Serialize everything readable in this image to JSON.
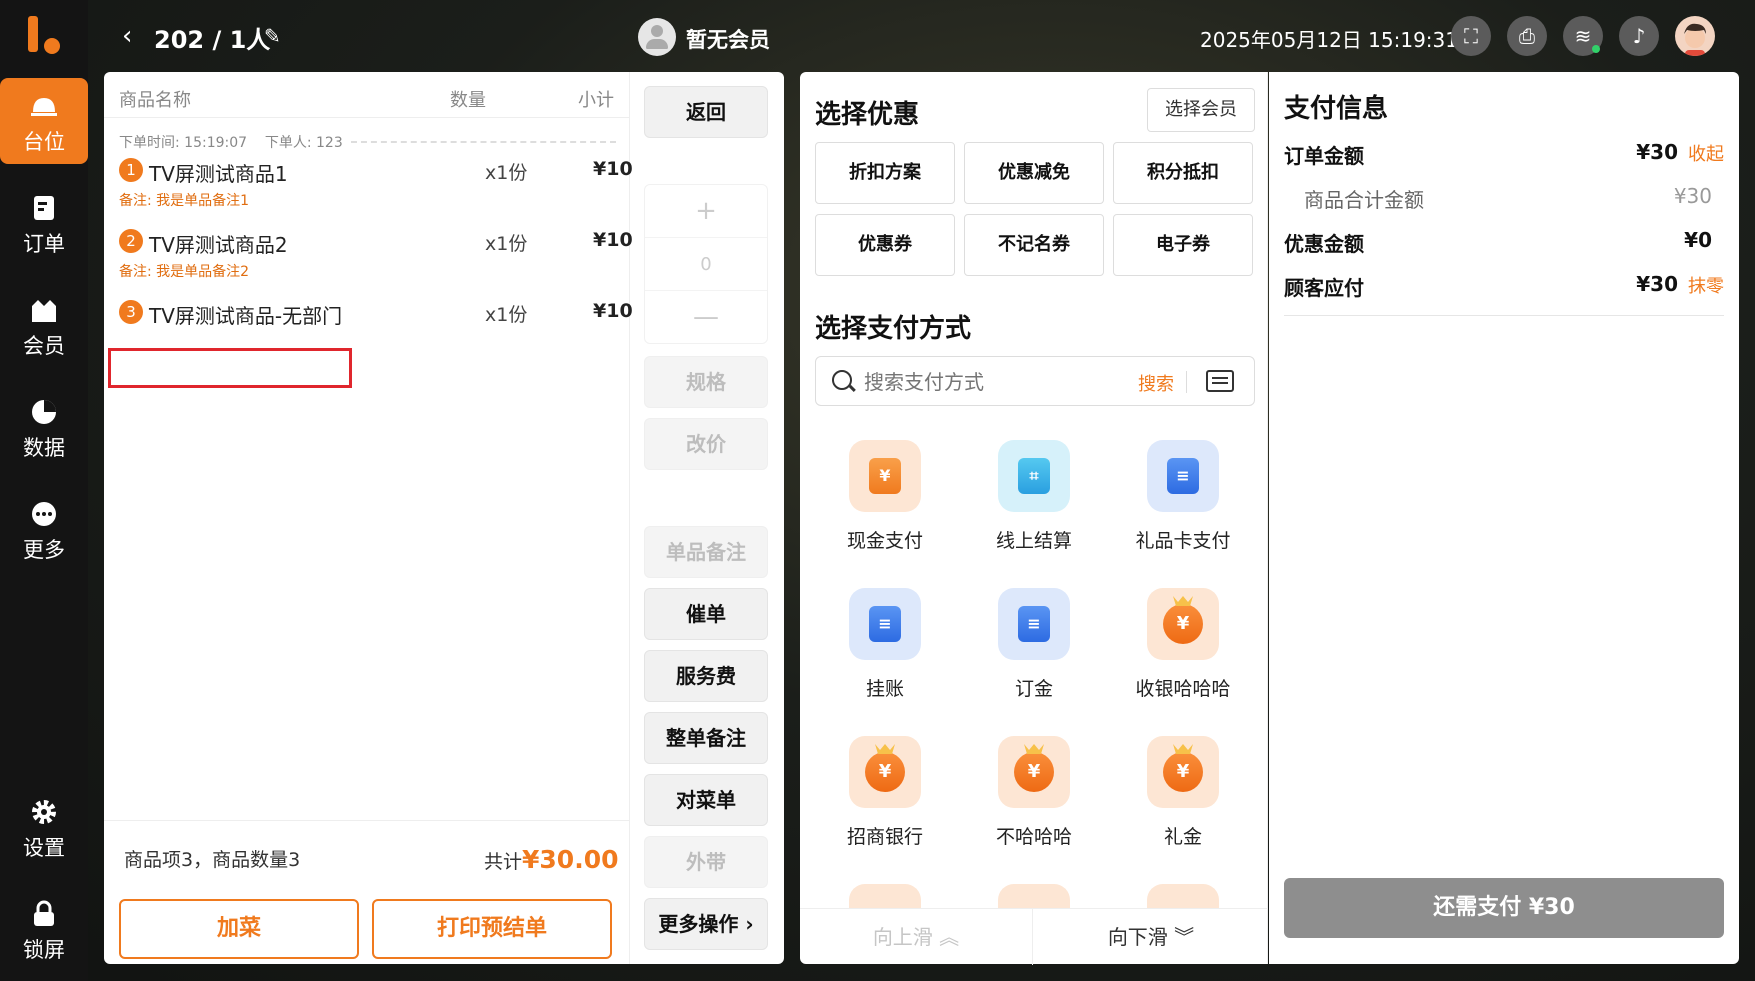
{
  "sidebar": {
    "items": [
      {
        "label": "台位",
        "icon": "table-icon",
        "active": true
      },
      {
        "label": "订单",
        "icon": "order-icon"
      },
      {
        "label": "会员",
        "icon": "member-icon"
      },
      {
        "label": "数据",
        "icon": "chart-icon"
      },
      {
        "label": "更多",
        "icon": "more-icon"
      },
      {
        "label": "设置",
        "icon": "gear-icon"
      },
      {
        "label": "锁屏",
        "icon": "lock-icon"
      }
    ]
  },
  "topbar": {
    "table_title": "202 / 1人",
    "member_status": "暂无会员",
    "datetime": "2025年05月12日 15:19:31"
  },
  "order": {
    "headers": {
      "name": "商品名称",
      "qty": "数量",
      "subtotal": "小计"
    },
    "meta": "下单时间: 15:19:07    下单人: 123",
    "items": [
      {
        "index": "1",
        "name": "TV屏测试商品1",
        "qty": "x1份",
        "price": "¥10",
        "note": "备注: 我是单品备注1"
      },
      {
        "index": "2",
        "name": "TV屏测试商品2",
        "qty": "x1份",
        "price": "¥10",
        "note": "备注: 我是单品备注2"
      },
      {
        "index": "3",
        "name": "TV屏测试商品-无部门",
        "qty": "x1份",
        "price": "¥10",
        "note": ""
      }
    ],
    "summary_count": "商品项3，商品数量3",
    "total_label": "共计",
    "total_value": "¥30.00",
    "add_dish": "加菜",
    "print_pre": "打印预结单"
  },
  "actions": {
    "back": "返回",
    "stepper_plus": "+",
    "stepper_value": "0",
    "stepper_minus": "—",
    "spec": "规格",
    "reprice": "改价",
    "item_note": "单品备注",
    "rush": "催单",
    "service_fee": "服务费",
    "order_note": "整单备注",
    "check_dish": "对菜单",
    "takeout": "外带",
    "more_ops": "更多操作"
  },
  "discount": {
    "title": "选择优惠",
    "select_member": "选择会员",
    "options": [
      "折扣方案",
      "优惠减免",
      "积分抵扣",
      "优惠券",
      "不记名券",
      "电子券"
    ]
  },
  "payment": {
    "title": "选择支付方式",
    "search_placeholder": "搜索支付方式",
    "search_button": "搜索",
    "methods": [
      {
        "label": "现金支付",
        "icon": "cash-icon",
        "glyph": "¥"
      },
      {
        "label": "线上结算",
        "icon": "online-scan-icon",
        "glyph": "⌗"
      },
      {
        "label": "礼品卡支付",
        "icon": "gift-card-icon",
        "glyph": "≡"
      },
      {
        "label": "挂账",
        "icon": "credit-icon",
        "glyph": "≡"
      },
      {
        "label": "订金",
        "icon": "deposit-icon",
        "glyph": "≡"
      },
      {
        "label": "收银哈哈哈",
        "icon": "money-bag-icon",
        "glyph": "¥"
      },
      {
        "label": "招商银行",
        "icon": "money-bag-icon",
        "glyph": "¥"
      },
      {
        "label": "不哈哈哈",
        "icon": "money-bag-icon",
        "glyph": "¥"
      },
      {
        "label": "礼金",
        "icon": "money-bag-icon",
        "glyph": "¥"
      }
    ],
    "scroll_up": "向上滑",
    "scroll_down": "向下滑"
  },
  "info": {
    "title": "支付信息",
    "order_amount_label": "订单金额",
    "order_amount": "¥30",
    "collapse": "收起",
    "goods_total_label": "商品合计金额",
    "goods_total": "¥30",
    "discount_label": "优惠金额",
    "discount_amount": "¥0",
    "payable_label": "顾客应付",
    "payable": "¥30",
    "round_off": "抹零",
    "pay_button": "还需支付 ¥30"
  },
  "colors": {
    "accent": "#f07a1e",
    "highlight_box": "#e0262d",
    "pay_button": "#8e8e8e"
  }
}
